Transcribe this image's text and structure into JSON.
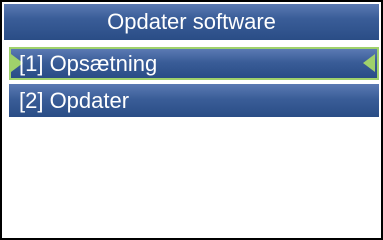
{
  "header": {
    "title": "Opdater software"
  },
  "menu": {
    "items": [
      {
        "label": "[1] Opsætning",
        "selected": true
      },
      {
        "label": "[2] Opdater",
        "selected": false
      }
    ]
  },
  "colors": {
    "bar": "#3a5d98",
    "selection": "#9fd16b",
    "text": "#ffffff",
    "background": "#ffffff"
  },
  "icons": {
    "selection_left": "selection-arrow-right-icon",
    "selection_right": "selection-arrow-left-icon"
  }
}
